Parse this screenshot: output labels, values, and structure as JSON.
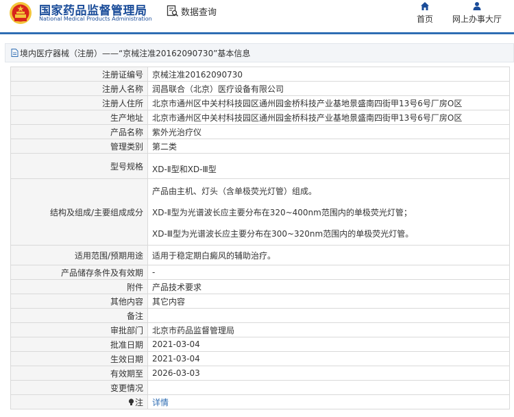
{
  "header": {
    "logo_cn": "国家药品监督管理局",
    "logo_en": "National Medical Products Administration",
    "search_label": "数据查询",
    "nav": [
      {
        "label": "首页",
        "icon": "home-icon"
      },
      {
        "label": "网上办事大厅",
        "icon": "user-icon"
      }
    ]
  },
  "breadcrumb": {
    "text": "境内医疗器械（注册）——“京械注准20162090730”基本信息"
  },
  "colors": {
    "brand": "#1a4c99",
    "accent": "#2e6db3",
    "label_bg": "#f5f5f5",
    "border": "#d9d9d9",
    "emblem_red": "#d7261b",
    "emblem_gold": "#f3c53a"
  },
  "table": {
    "rows": [
      {
        "label": "注册证编号",
        "lines": [
          "京械注准20162090730"
        ]
      },
      {
        "label": "注册人名称",
        "lines": [
          "润昌联合（北京）医疗设备有限公司"
        ]
      },
      {
        "label": "注册人住所",
        "lines": [
          "北京市通州区中关村科技园区通州园金桥科技产业基地景盛南四街甲13号6号厂房O区"
        ]
      },
      {
        "label": "生产地址",
        "lines": [
          "北京市通州区中关村科技园区通州园金桥科技产业基地景盛南四街甲13号6号厂房O区"
        ]
      },
      {
        "label": "产品名称",
        "lines": [
          "紫外光治疗仪"
        ]
      },
      {
        "label": "管理类别",
        "lines": [
          "第二类"
        ]
      },
      {
        "label": "型号规格",
        "lines": [
          "XD-Ⅱ型和XD-Ⅲ型"
        ]
      },
      {
        "label": "结构及组成/主要组成成分",
        "lines": [
          "产品由主机、灯头（含单极荧光灯管）组成。",
          "XD-Ⅱ型为光谱波长应主要分布在320~400nm范围内的单极荧光灯管；",
          "XD-Ⅲ型为光谱波长应主要分布在300~320nm范围内的单极荧光灯管。"
        ]
      },
      {
        "label": "适用范围/预期用途",
        "lines": [
          "适用于稳定期白癜风的辅助治疗。"
        ]
      },
      {
        "label": "产品储存条件及有效期",
        "lines": [
          "-"
        ]
      },
      {
        "label": "附件",
        "lines": [
          "产品技术要求"
        ]
      },
      {
        "label": "其他内容",
        "lines": [
          "其它内容"
        ]
      },
      {
        "label": "备注",
        "lines": [
          ""
        ]
      },
      {
        "label": "审批部门",
        "lines": [
          "北京市药品监督管理局"
        ]
      },
      {
        "label": "批准日期",
        "lines": [
          "2021-03-04"
        ]
      },
      {
        "label": "生效日期",
        "lines": [
          "2021-03-04"
        ]
      },
      {
        "label": "有效期至",
        "lines": [
          "2026-03-03"
        ]
      },
      {
        "label": "变更情况",
        "lines": [
          ""
        ]
      }
    ],
    "note_row": {
      "label": "注",
      "icon": "info-bulb-icon",
      "link": "详情"
    }
  }
}
